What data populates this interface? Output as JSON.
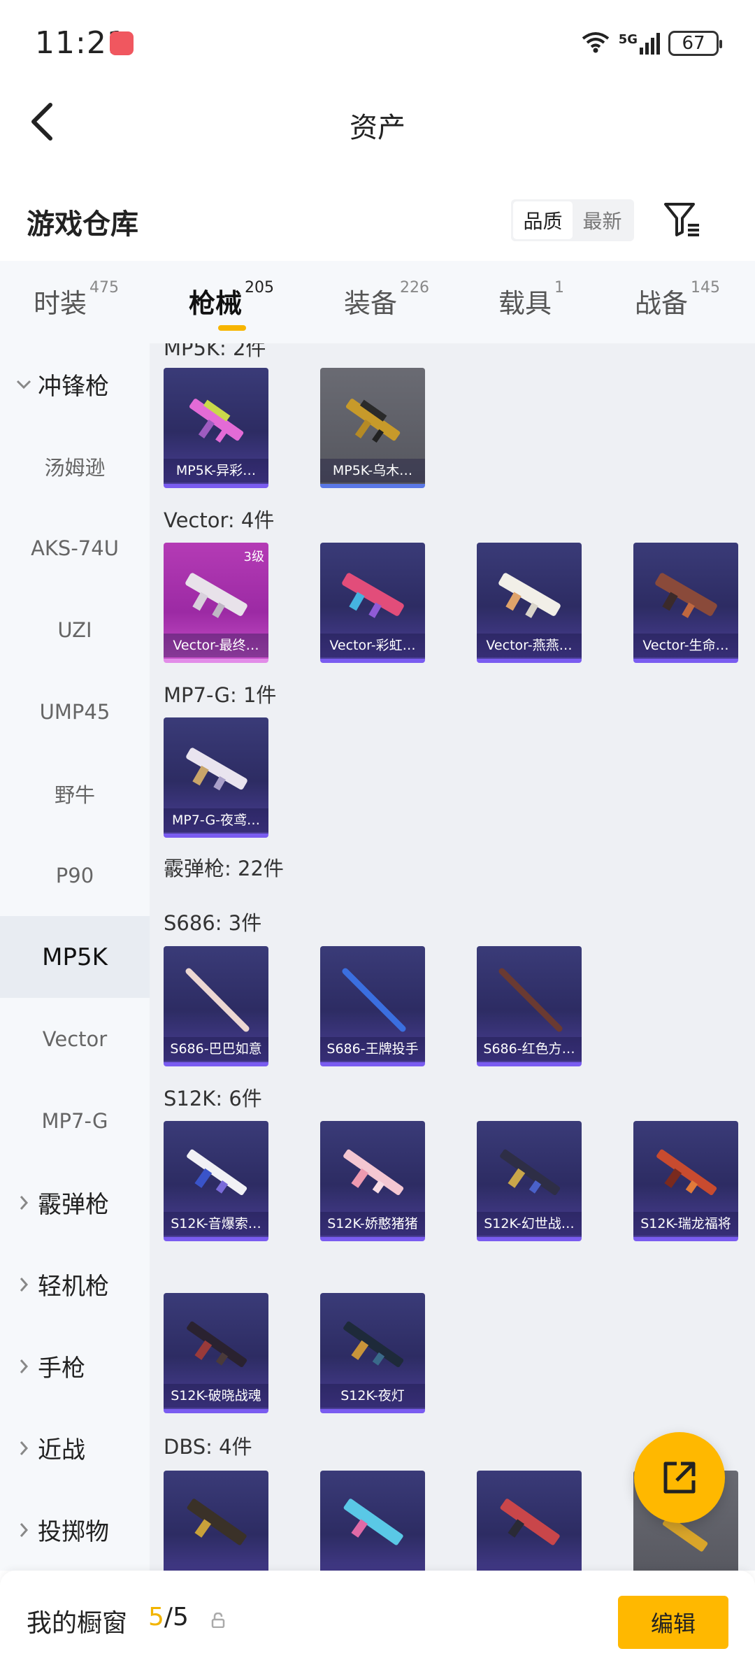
{
  "status": {
    "time": "11:21",
    "network": "5G",
    "battery": "67"
  },
  "header": {
    "title": "资产"
  },
  "section": {
    "title": "游戏仓库",
    "sort": [
      "品质",
      "最新"
    ]
  },
  "tabs": [
    {
      "label": "时装",
      "count": "475"
    },
    {
      "label": "枪械",
      "count": "205"
    },
    {
      "label": "装备",
      "count": "226"
    },
    {
      "label": "载具",
      "count": "1"
    },
    {
      "label": "战备",
      "count": "145"
    }
  ],
  "sidebar": {
    "category": "冲锋枪",
    "items": [
      "汤姆逊",
      "AKS-74U",
      "UZI",
      "UMP45",
      "野牛",
      "P90",
      "MP5K",
      "Vector",
      "MP7-G"
    ],
    "categories": [
      "霰弹枪",
      "轻机枪",
      "手枪",
      "近战",
      "投掷物"
    ]
  },
  "groups": {
    "mp5k": {
      "label": "MP5K: 2件",
      "items": [
        "MP5K-异彩…",
        "MP5K-乌木…"
      ]
    },
    "vector": {
      "label": "Vector: 4件",
      "tier": "3级",
      "items": [
        "Vector-最终…",
        "Vector-彩虹…",
        "Vector-燕燕…",
        "Vector-生命…"
      ]
    },
    "mp7g": {
      "label": "MP7-G: 1件",
      "items": [
        "MP7-G-夜鸢…"
      ]
    },
    "shotgun_total": "霰弹枪: 22件",
    "s686": {
      "label": "S686: 3件",
      "items": [
        "S686-巴巴如意",
        "S686-王牌投手",
        "S686-红色方…"
      ]
    },
    "s12k": {
      "label": "S12K: 6件",
      "items": [
        "S12K-音爆索…",
        "S12K-娇憨猪猪",
        "S12K-幻世战…",
        "S12K-瑞龙福将",
        "S12K-破晓战魂",
        "S12K-夜灯"
      ]
    },
    "dbs": {
      "label": "DBS: 4件"
    }
  },
  "bottom": {
    "label": "我的橱窗",
    "count_current": "5",
    "count_total": "/5",
    "edit": "编辑"
  },
  "colors": {
    "accent": "#ffb800"
  }
}
